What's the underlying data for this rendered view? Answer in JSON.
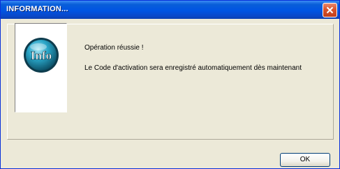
{
  "window": {
    "title": "INFORMATION...",
    "close_icon": "close-icon"
  },
  "dialog": {
    "icon": "info-icon",
    "icon_text": "Info",
    "message_title": "Opération réussie !",
    "message_body": "Le Code d'activation sera enregistré  automatiquement dès maintenant",
    "ok_label": "OK"
  }
}
